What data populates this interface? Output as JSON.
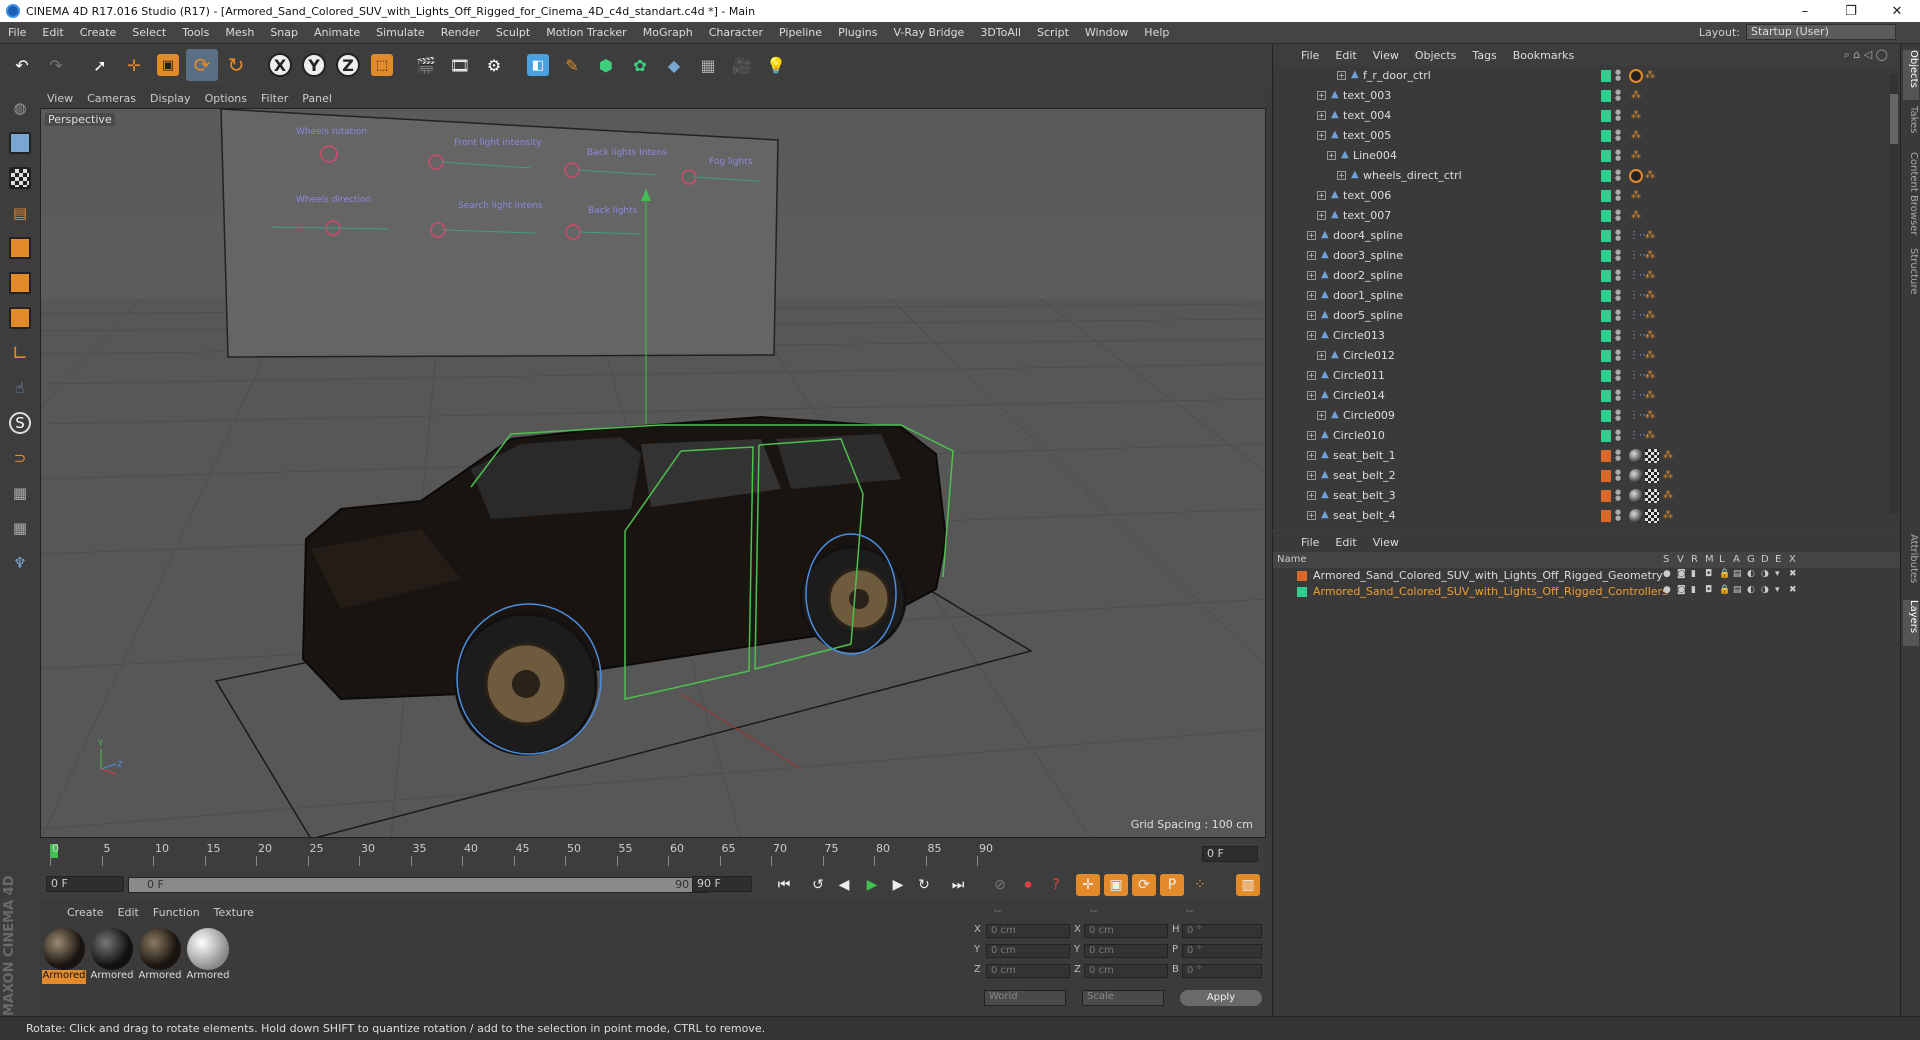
{
  "window": {
    "title": "CINEMA 4D R17.016 Studio (R17) - [Armored_Sand_Colored_SUV_with_Lights_Off_Rigged_for_Cinema_4D_c4d_standart.c4d *] - Main",
    "minimize": "–",
    "maximize": "❐",
    "close": "✕"
  },
  "menubar": {
    "items": [
      "File",
      "Edit",
      "Create",
      "Select",
      "Tools",
      "Mesh",
      "Snap",
      "Animate",
      "Simulate",
      "Render",
      "Sculpt",
      "Motion Tracker",
      "MoGraph",
      "Character",
      "Pipeline",
      "Plugins",
      "V-Ray Bridge",
      "3DToAll",
      "Script",
      "Window",
      "Help"
    ],
    "layout_label": "Layout:",
    "layout_value": "Startup (User)"
  },
  "viewport": {
    "menu": [
      "View",
      "Cameras",
      "Display",
      "Options",
      "Filter",
      "Panel"
    ],
    "label": "Perspective",
    "grid_spacing": "Grid Spacing : 100 cm",
    "billboard_labels": [
      "Wheels rotation",
      "Front light intensity",
      "Back lights Intens",
      "Fog lights",
      "Wheels direction",
      "Search light intens",
      "Back lights"
    ]
  },
  "timeline": {
    "ticks": [
      "0",
      "5",
      "10",
      "15",
      "20",
      "25",
      "30",
      "35",
      "40",
      "45",
      "50",
      "55",
      "60",
      "65",
      "70",
      "75",
      "80",
      "85",
      "90"
    ],
    "current_frame": "0 F",
    "start_field": "0 F",
    "slider_start": "0 F",
    "slider_end": "90 F",
    "end_field": "90 F"
  },
  "materials": {
    "menu": [
      "Create",
      "Edit",
      "Function",
      "Texture"
    ],
    "items": [
      "Armored",
      "Armored",
      "Armored",
      "Armored"
    ]
  },
  "coords": {
    "header": [
      "--",
      "--",
      "--"
    ],
    "rows": [
      {
        "a": "X",
        "av": "0 cm",
        "b": "X",
        "bv": "0 cm",
        "c": "H",
        "cv": "0 °"
      },
      {
        "a": "Y",
        "av": "0 cm",
        "b": "Y",
        "bv": "0 cm",
        "c": "P",
        "cv": "0 °"
      },
      {
        "a": "Z",
        "av": "0 cm",
        "b": "Z",
        "bv": "0 cm",
        "c": "B",
        "cv": "0 °"
      }
    ],
    "world": "World",
    "scale": "Scale",
    "apply": "Apply"
  },
  "status": "Rotate: Click and drag to rotate elements. Hold down SHIFT to quantize rotation / add to the selection in point mode, CTRL to remove.",
  "brand": "MAXON CINEMA 4D",
  "object_manager": {
    "menu": [
      "File",
      "Edit",
      "View",
      "Objects",
      "Tags",
      "Bookmarks"
    ],
    "rows": [
      {
        "name": "f_r_door_ctrl",
        "indent": 3,
        "layer": "#2fd08f",
        "tags": "stop"
      },
      {
        "name": "text_003",
        "indent": 1,
        "layer": "#2fd08f",
        "tags": "pt"
      },
      {
        "name": "text_004",
        "indent": 1,
        "layer": "#2fd08f",
        "tags": "pt"
      },
      {
        "name": "text_005",
        "indent": 1,
        "layer": "#2fd08f",
        "tags": "pt"
      },
      {
        "name": "Line004",
        "indent": 2,
        "layer": "#2fd08f",
        "tags": "pt"
      },
      {
        "name": "wheels_direct_ctrl",
        "indent": 3,
        "layer": "#2fd08f",
        "tags": "stop"
      },
      {
        "name": "text_006",
        "indent": 1,
        "layer": "#2fd08f",
        "tags": "pt"
      },
      {
        "name": "text_007",
        "indent": 1,
        "layer": "#2fd08f",
        "tags": "pt"
      },
      {
        "name": "door4_spline",
        "indent": 0,
        "layer": "#2fd08f",
        "tags": "sp"
      },
      {
        "name": "door3_spline",
        "indent": 0,
        "layer": "#2fd08f",
        "tags": "sp"
      },
      {
        "name": "door2_spline",
        "indent": 0,
        "layer": "#2fd08f",
        "tags": "sp"
      },
      {
        "name": "door1_spline",
        "indent": 0,
        "layer": "#2fd08f",
        "tags": "sp"
      },
      {
        "name": "door5_spline",
        "indent": 0,
        "layer": "#2fd08f",
        "tags": "sp"
      },
      {
        "name": "Circle013",
        "indent": 0,
        "layer": "#2fd08f",
        "tags": "sp"
      },
      {
        "name": "Circle012",
        "indent": 1,
        "layer": "#2fd08f",
        "tags": "sp"
      },
      {
        "name": "Circle011",
        "indent": 0,
        "layer": "#2fd08f",
        "tags": "sp"
      },
      {
        "name": "Circle014",
        "indent": 0,
        "layer": "#2fd08f",
        "tags": "sp"
      },
      {
        "name": "Circle009",
        "indent": 1,
        "layer": "#2fd08f",
        "tags": "sp"
      },
      {
        "name": "Circle010",
        "indent": 0,
        "layer": "#2fd08f",
        "tags": "sp"
      },
      {
        "name": "seat_belt_1",
        "indent": 0,
        "layer": "#d8692a",
        "tags": "mat"
      },
      {
        "name": "seat_belt_2",
        "indent": 0,
        "layer": "#d8692a",
        "tags": "mat"
      },
      {
        "name": "seat_belt_3",
        "indent": 0,
        "layer": "#d8692a",
        "tags": "mat"
      },
      {
        "name": "seat_belt_4",
        "indent": 0,
        "layer": "#d8692a",
        "tags": "mat"
      }
    ]
  },
  "side_tabs": [
    "Objects",
    "Takes",
    "Content Browser",
    "Structure",
    "Attributes",
    "Layers"
  ],
  "layer_manager": {
    "menu": [
      "File",
      "Edit",
      "View"
    ],
    "header_name": "Name",
    "columns": [
      "S",
      "V",
      "R",
      "M",
      "L",
      "A",
      "G",
      "D",
      "E",
      "X"
    ],
    "rows": [
      {
        "name": "Armored_Sand_Colored_SUV_with_Lights_Off_Rigged_Geometry",
        "color": "#d8692a",
        "text_color": "#dddddd"
      },
      {
        "name": "Armored_Sand_Colored_SUV_with_Lights_Off_Rigged_Controllers",
        "color": "#2fd08f",
        "text_color": "#f0a030"
      }
    ]
  },
  "colors": {
    "accent": "#e38b2a",
    "selection": "#5b6f84",
    "layer_green": "#2fd08f",
    "layer_orange": "#d8692a"
  }
}
